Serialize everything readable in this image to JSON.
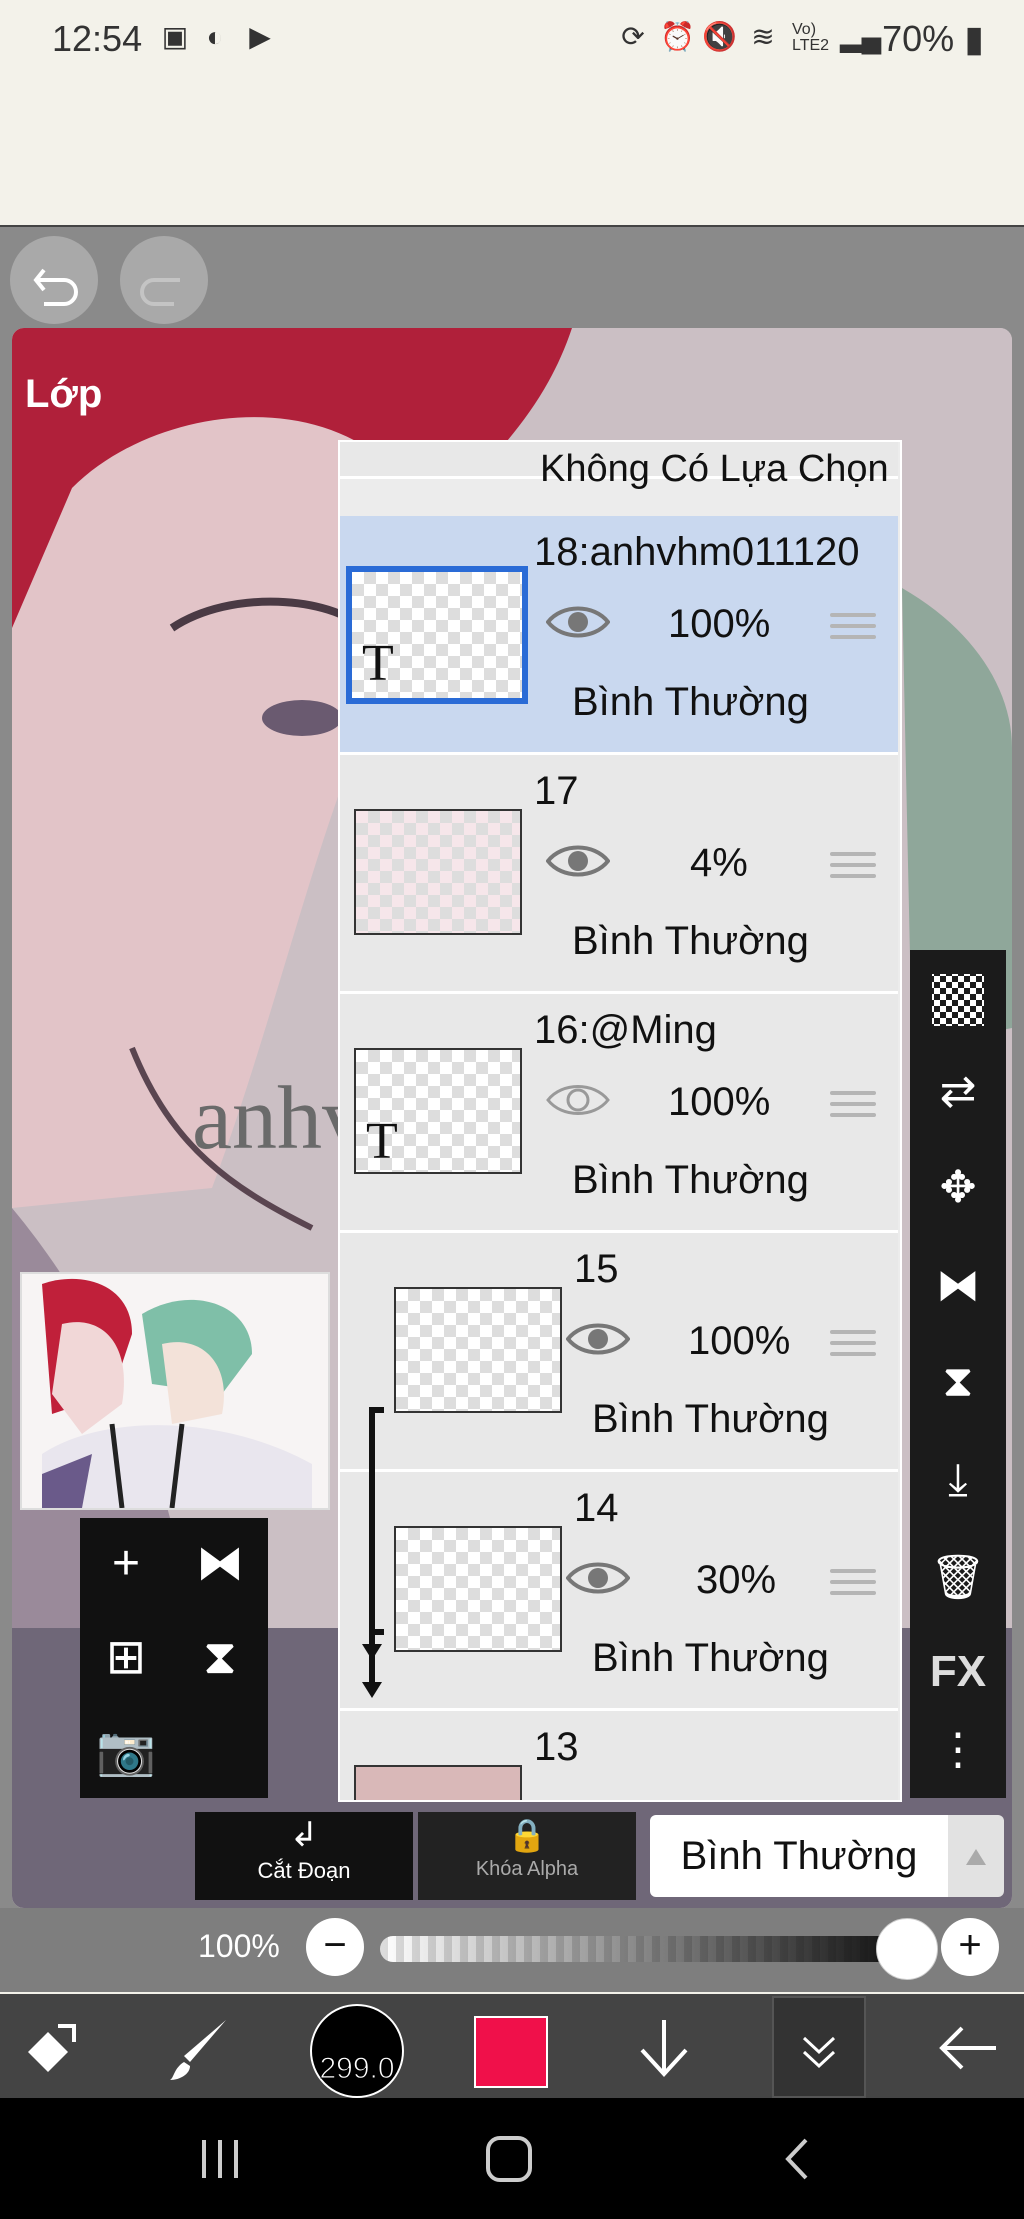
{
  "status_bar": {
    "time": "12:54",
    "battery": "70%",
    "network_badge": "Vo) LTE2"
  },
  "panel_title": "Lớp",
  "layers": {
    "top_partial": {
      "label": "Không Có Lựa Chọn"
    },
    "items": [
      {
        "name": "18:anhvhm011120",
        "opacity": "100%",
        "blend": "Bình Thường",
        "selected": true,
        "visible": true
      },
      {
        "name": "17",
        "opacity": "4%",
        "blend": "Bình Thường",
        "selected": false,
        "visible": true
      },
      {
        "name": "16:@Ming",
        "opacity": "100%",
        "blend": "Bình Thường",
        "selected": false,
        "visible": false
      },
      {
        "name": "15",
        "opacity": "100%",
        "blend": "Bình Thường",
        "selected": false,
        "visible": true
      },
      {
        "name": "14",
        "opacity": "30%",
        "blend": "Bình Thường",
        "selected": false,
        "visible": true
      },
      {
        "name": "13"
      }
    ]
  },
  "canvas_watermark": "anhv",
  "right_toolbar": {
    "fx_label": "FX"
  },
  "bottom_actions": {
    "clip_label": "Cắt Đoạn",
    "alpha_lock_label": "Khóa Alpha",
    "blend_mode": "Bình Thường"
  },
  "opacity_bar": {
    "value": "100%",
    "minus": "−",
    "plus": "+",
    "level": 1.0
  },
  "bottom_toolbar": {
    "brush_size": "299.0",
    "color": "#f0104a"
  },
  "colors": {
    "selection": "#2a6bd6",
    "selected_row": "#c9d8ef",
    "accent_red": "#f0104a"
  },
  "icons": [
    "undo-icon",
    "redo-icon",
    "eye-icon",
    "drag-handle-icon",
    "checker-icon",
    "swap-layer-icon",
    "move-icon",
    "flip-h-icon",
    "flip-v-icon",
    "merge-down-icon",
    "trash-icon",
    "more-icon",
    "add-icon",
    "camera-icon",
    "lock-icon",
    "chevron-down-icon",
    "arrow-down-icon",
    "back-arrow-icon",
    "brush-icon",
    "transform-icon"
  ]
}
